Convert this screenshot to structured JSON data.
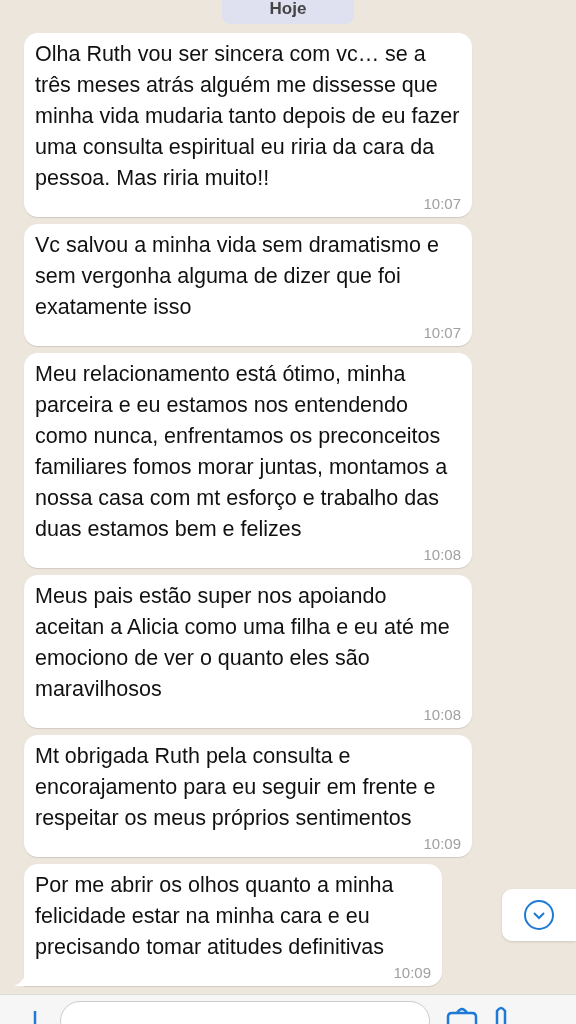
{
  "date_label": "Hoje",
  "messages": [
    {
      "text": "Olha Ruth vou ser sincera com vc… se a três meses atrás alguém me dissesse que minha vida mudaria tanto depois de eu fazer uma consulta espiritual eu riria da cara da pessoa. Mas riria muito!!",
      "time": "10:07",
      "tail": false
    },
    {
      "text": "Vc salvou a minha vida sem dramatismo e sem vergonha alguma de dizer que foi exatamente isso",
      "time": "10:07",
      "tail": false
    },
    {
      "text": "Meu relacionamento está ótimo, minha parceira e eu estamos nos entendendo como nunca, enfrentamos os preconceitos familiares fomos morar juntas, montamos a nossa casa com mt esforço e trabalho das duas estamos bem e felizes",
      "time": "10:08",
      "tail": false
    },
    {
      "text": "Meus pais estão super nos apoiando aceitan a Alicia como uma filha e eu até me emociono de ver o quanto eles são maravilhosos",
      "time": "10:08",
      "tail": false
    },
    {
      "text": "Mt obrigada Ruth pela consulta e encorajamento para eu seguir em frente e respeitar os meus próprios sentimentos",
      "time": "10:09",
      "tail": false
    },
    {
      "text": "Por me abrir os olhos quanto a minha felicidade estar na minha cara e eu precisando tomar atitudes definitivas",
      "time": "10:09",
      "tail": true
    }
  ]
}
